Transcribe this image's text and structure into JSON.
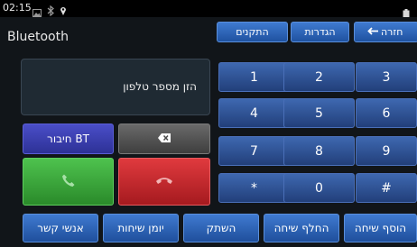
{
  "status": {
    "time": "02:15",
    "icons": [
      "image-icon",
      "bluetooth-icon",
      "location-icon",
      "battery-icon"
    ]
  },
  "header": {
    "title": "Bluetooth",
    "btn_devices": "התקנים",
    "btn_settings": "הגדרות",
    "btn_back": "חזרה",
    "back_icon": "arrow-left-icon"
  },
  "display": {
    "placeholder": "הזן מספר טלפון"
  },
  "controls": {
    "connect_bt": "חיבור BT",
    "backspace_icon": "backspace-icon",
    "call_icon": "phone-answer-icon",
    "hangup_icon": "phone-hangup-icon"
  },
  "keypad": [
    "1",
    "2",
    "3",
    "4",
    "5",
    "6",
    "7",
    "8",
    "9",
    "*",
    "0",
    "#"
  ],
  "bottom_bar": {
    "contacts": "אנשי קשר",
    "call_log": "יומן שיחות",
    "mute": "השתק",
    "swap_call": "החלף שיחה",
    "add_call": "הוסף שיחה"
  },
  "colors": {
    "accent_blue": "#2f67bd",
    "call_green": "#3aa83a",
    "hangup_red": "#c8262c",
    "connect_purple": "#3b3fb0"
  }
}
